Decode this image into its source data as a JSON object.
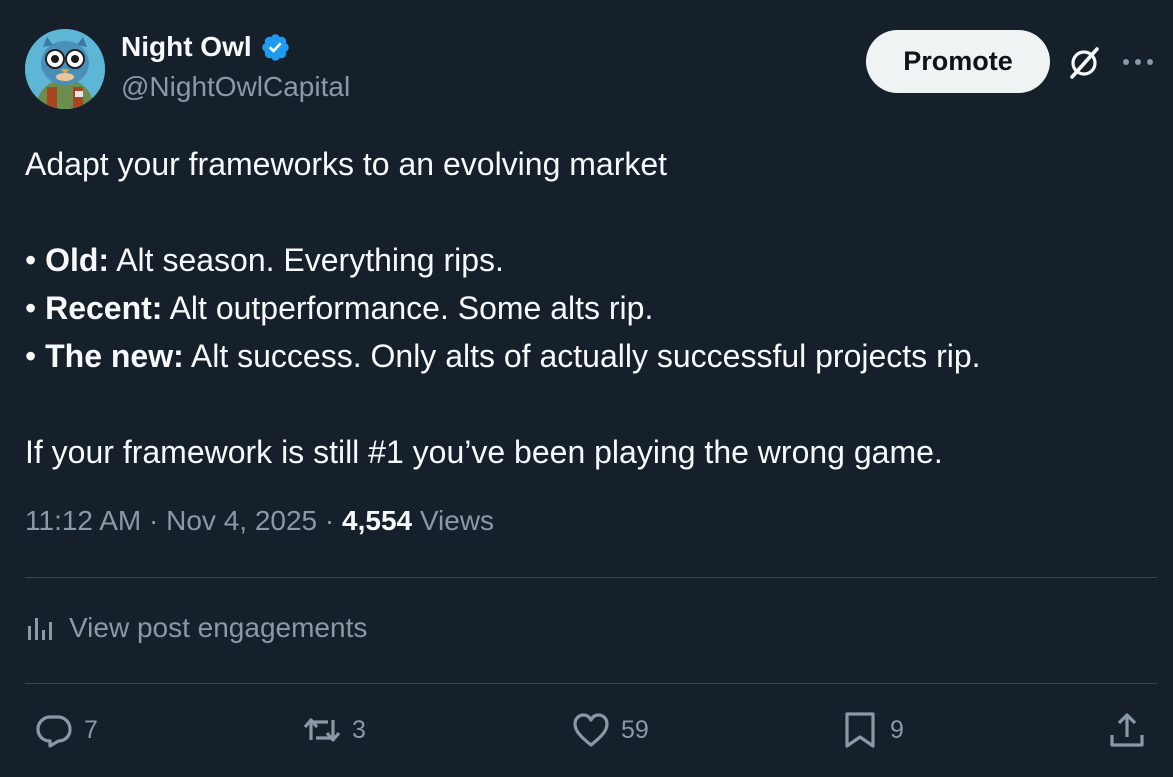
{
  "author": {
    "name": "Night Owl",
    "handle": "@NightOwlCapital",
    "verified_color": "#1d9bf0"
  },
  "header": {
    "promote_label": "Promote",
    "grok_icon": "grok-icon",
    "more_icon": "more-icon"
  },
  "post": {
    "line1": "Adapt your frameworks to an evolving market",
    "bullets": [
      {
        "prefix": "• ",
        "label": "Old:",
        "text": " Alt season. Everything rips."
      },
      {
        "prefix": "• ",
        "label": "Recent:",
        "text": " Alt outperformance. Some alts rip."
      },
      {
        "prefix": "• ",
        "label": "The new:",
        "text": " Alt success. Only alts of actually successful projects rip."
      }
    ],
    "closing": "If your framework is still #1 you’ve been playing the wrong game."
  },
  "meta": {
    "time": "11:12 AM",
    "sep1": " · ",
    "date": "Nov 4, 2025",
    "sep2": " · ",
    "views_count": "4,554",
    "views_label": " Views"
  },
  "engagements": {
    "label": "View post engagements"
  },
  "actions": {
    "replies": "7",
    "reposts": "3",
    "likes": "59",
    "bookmarks": "9"
  },
  "colors": {
    "background": "#15202b",
    "text": "#f7f9f9",
    "muted": "#8b98a5",
    "divider": "#38444d",
    "accent": "#1d9bf0"
  }
}
